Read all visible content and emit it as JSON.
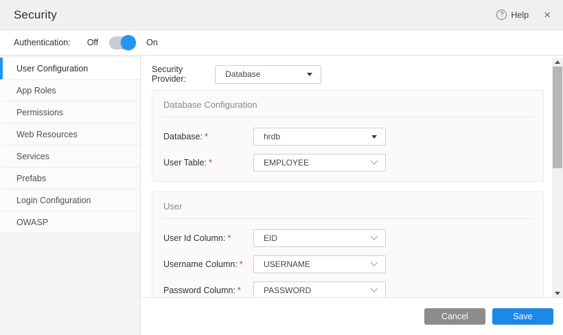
{
  "header": {
    "title": "Security",
    "help_label": "Help",
    "help_icon": "question-circle-icon",
    "close_icon": "close-icon",
    "help_glyph": "?",
    "close_glyph": "×"
  },
  "auth": {
    "label": "Authentication:",
    "off_label": "Off",
    "on_label": "On",
    "state": "On"
  },
  "sidebar": {
    "items": [
      {
        "label": "User Configuration",
        "active": true
      },
      {
        "label": "App Roles",
        "active": false
      },
      {
        "label": "Permissions",
        "active": false
      },
      {
        "label": "Web Resources",
        "active": false
      },
      {
        "label": "Services",
        "active": false
      },
      {
        "label": "Prefabs",
        "active": false
      },
      {
        "label": "Login Configuration",
        "active": false
      },
      {
        "label": "OWASP",
        "active": false
      }
    ]
  },
  "provider": {
    "label": "Security Provider:",
    "value": "Database"
  },
  "required_marker": "*",
  "sections": [
    {
      "title": "Database Configuration",
      "fields": [
        {
          "label": "Database:",
          "value": "hrdb"
        },
        {
          "label": "User Table:",
          "value": "EMPLOYEE"
        }
      ]
    },
    {
      "title": "User",
      "fields": [
        {
          "label": "User Id Column:",
          "value": "EID"
        },
        {
          "label": "Username Column:",
          "value": "USERNAME"
        },
        {
          "label": "Password Column:",
          "value": "PASSWORD"
        }
      ]
    }
  ],
  "footer": {
    "cancel_label": "Cancel",
    "save_label": "Save"
  },
  "colors": {
    "accent": "#1e88e5",
    "toggle_knob": "#2196f3",
    "cancel_button": "#8c8c8c",
    "required": "#e02b2b",
    "header_bg": "#f0f0f0"
  }
}
